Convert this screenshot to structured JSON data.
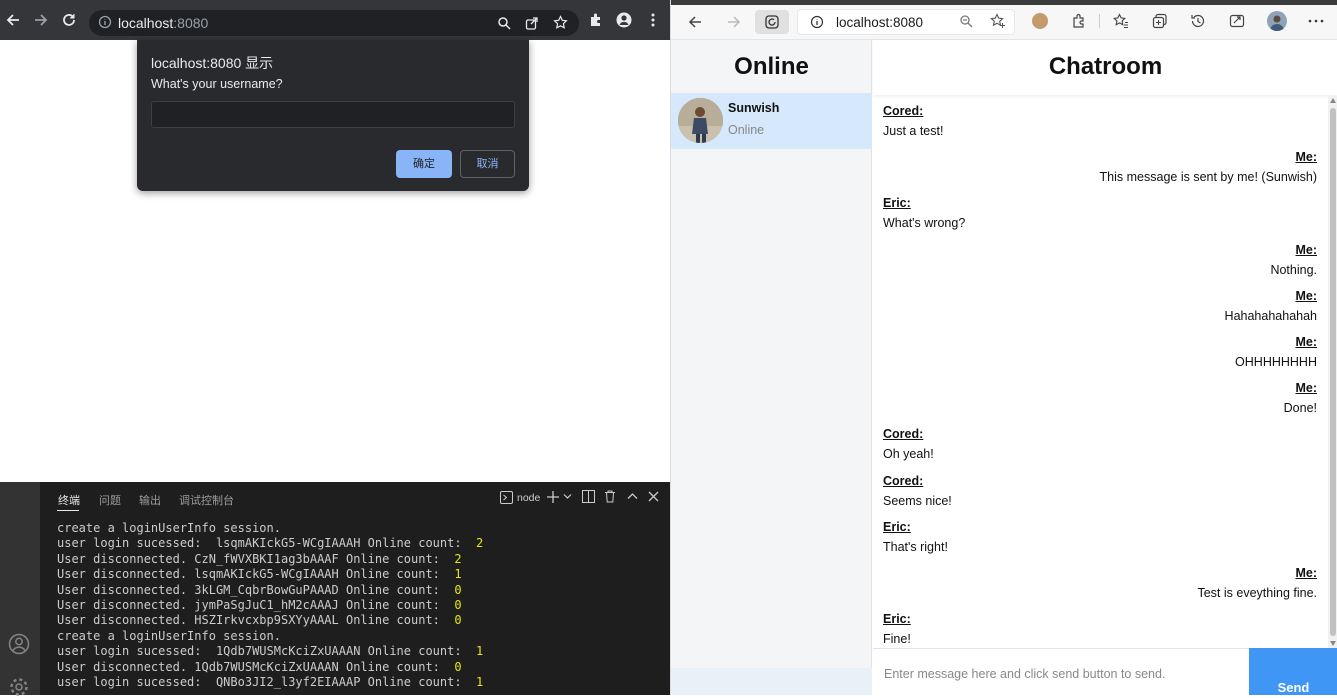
{
  "left_browser": {
    "address": {
      "host": "localhost",
      "port": ":8080"
    }
  },
  "dialog": {
    "title": "localhost:8080 显示",
    "message": "What's your username?",
    "input_value": "",
    "ok_label": "确定",
    "cancel_label": "取消"
  },
  "terminal": {
    "tabs": [
      "终端",
      "问题",
      "输出",
      "调试控制台"
    ],
    "active_tab": "终端",
    "process_label": "node",
    "lines": [
      {
        "text": "create a loginUserInfo session.",
        "num": ""
      },
      {
        "text": "user login sucessed:  lsqmAKIckG5-WCgIAAAH Online count:  ",
        "num": "2"
      },
      {
        "text": "User disconnected. CzN_fWVXBKI1ag3bAAAF Online count:  ",
        "num": "2"
      },
      {
        "text": "User disconnected. lsqmAKIckG5-WCgIAAAH Online count:  ",
        "num": "1"
      },
      {
        "text": "User disconnected. 3kLGM_CqbrBowGuPAAAD Online count:  ",
        "num": "0"
      },
      {
        "text": "User disconnected. jymPaSgJuC1_hM2cAAAJ Online count:  ",
        "num": "0"
      },
      {
        "text": "User disconnected. HSZIrkvcxbp9SXYyAAAL Online count:  ",
        "num": "0"
      },
      {
        "text": "create a loginUserInfo session.",
        "num": ""
      },
      {
        "text": "user login sucessed:  1Qdb7WUSMcKciZxUAAAN Online count:  ",
        "num": "1"
      },
      {
        "text": "User disconnected. 1Qdb7WUSMcKciZxUAAAN Online count:  ",
        "num": "0"
      },
      {
        "text": "user login sucessed:  QNBo3JI2_l3yf2EIAAAP Online count:  ",
        "num": "1"
      }
    ]
  },
  "right_browser": {
    "address": {
      "host": "localhost:8080"
    }
  },
  "online": {
    "title": "Online",
    "users": [
      {
        "name": "Sunwish",
        "status": "Online"
      }
    ]
  },
  "chat": {
    "title": "Chatroom",
    "messages": [
      {
        "sender": "Cored:",
        "text": "Just a test!",
        "mine": false
      },
      {
        "sender": "Me:",
        "text": "This message is sent by me! (Sunwish)",
        "mine": true
      },
      {
        "sender": "Eric:",
        "text": "What's wrong?",
        "mine": false
      },
      {
        "sender": "Me:",
        "text": "Nothing.",
        "mine": true
      },
      {
        "sender": "Me:",
        "text": "Hahahahahahah",
        "mine": true
      },
      {
        "sender": "Me:",
        "text": "OHHHHHHHH",
        "mine": true
      },
      {
        "sender": "Me:",
        "text": "Done!",
        "mine": true
      },
      {
        "sender": "Cored:",
        "text": "Oh yeah!",
        "mine": false
      },
      {
        "sender": "Cored:",
        "text": "Seems nice!",
        "mine": false
      },
      {
        "sender": "Eric:",
        "text": "That's right!",
        "mine": false
      },
      {
        "sender": "Me:",
        "text": "Test is eveything fine.",
        "mine": true
      },
      {
        "sender": "Eric:",
        "text": "Fine!",
        "mine": false
      }
    ],
    "input_placeholder": "Enter message here and click send button to send.",
    "send_label": "Send"
  }
}
